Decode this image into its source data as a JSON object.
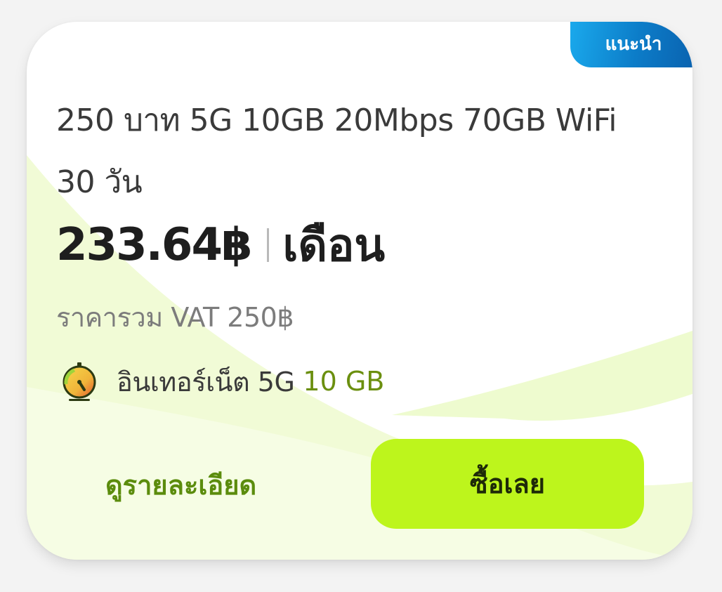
{
  "badge": {
    "label": "แนะนำ"
  },
  "plan": {
    "title": "250 บาท 5G 10GB 20Mbps 70GB WiFi 30 วัน",
    "price": "233.64฿",
    "period": "เดือน",
    "vat_note": "ราคารวม VAT 250฿"
  },
  "feature": {
    "icon": "speedometer-icon",
    "label": "อินเทอร์เน็ต 5G",
    "value": "10 GB"
  },
  "actions": {
    "details_label": "ดูรายละเอียด",
    "buy_label": "ซื้อเลย"
  },
  "colors": {
    "badge_blue": "#0c7cc8",
    "accent_green": "#bdf51c",
    "link_green": "#5b8c0c",
    "value_green": "#6b8f0f"
  }
}
